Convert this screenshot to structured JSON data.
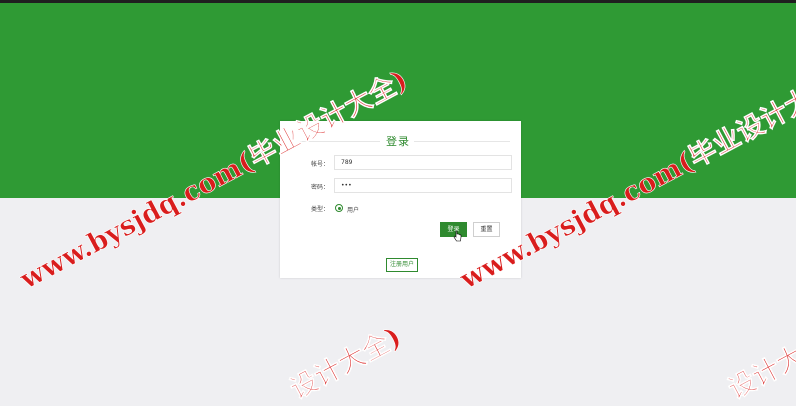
{
  "form": {
    "title": "登录",
    "account_label": "帐号：",
    "account_value": "789",
    "password_label": "密码：",
    "password_value": "•••",
    "type_label": "类型：",
    "role_option": "用户",
    "login_label": "登录",
    "reset_label": "重置",
    "register_label": "注册用户"
  },
  "watermark": {
    "text": "www.bysjdq.com(毕业设计大全)",
    "partial_text": "设计大全)"
  },
  "colors": {
    "banner": "#2f9a34",
    "accent": "#2f8a2f",
    "watermark": "#d91d1d"
  }
}
